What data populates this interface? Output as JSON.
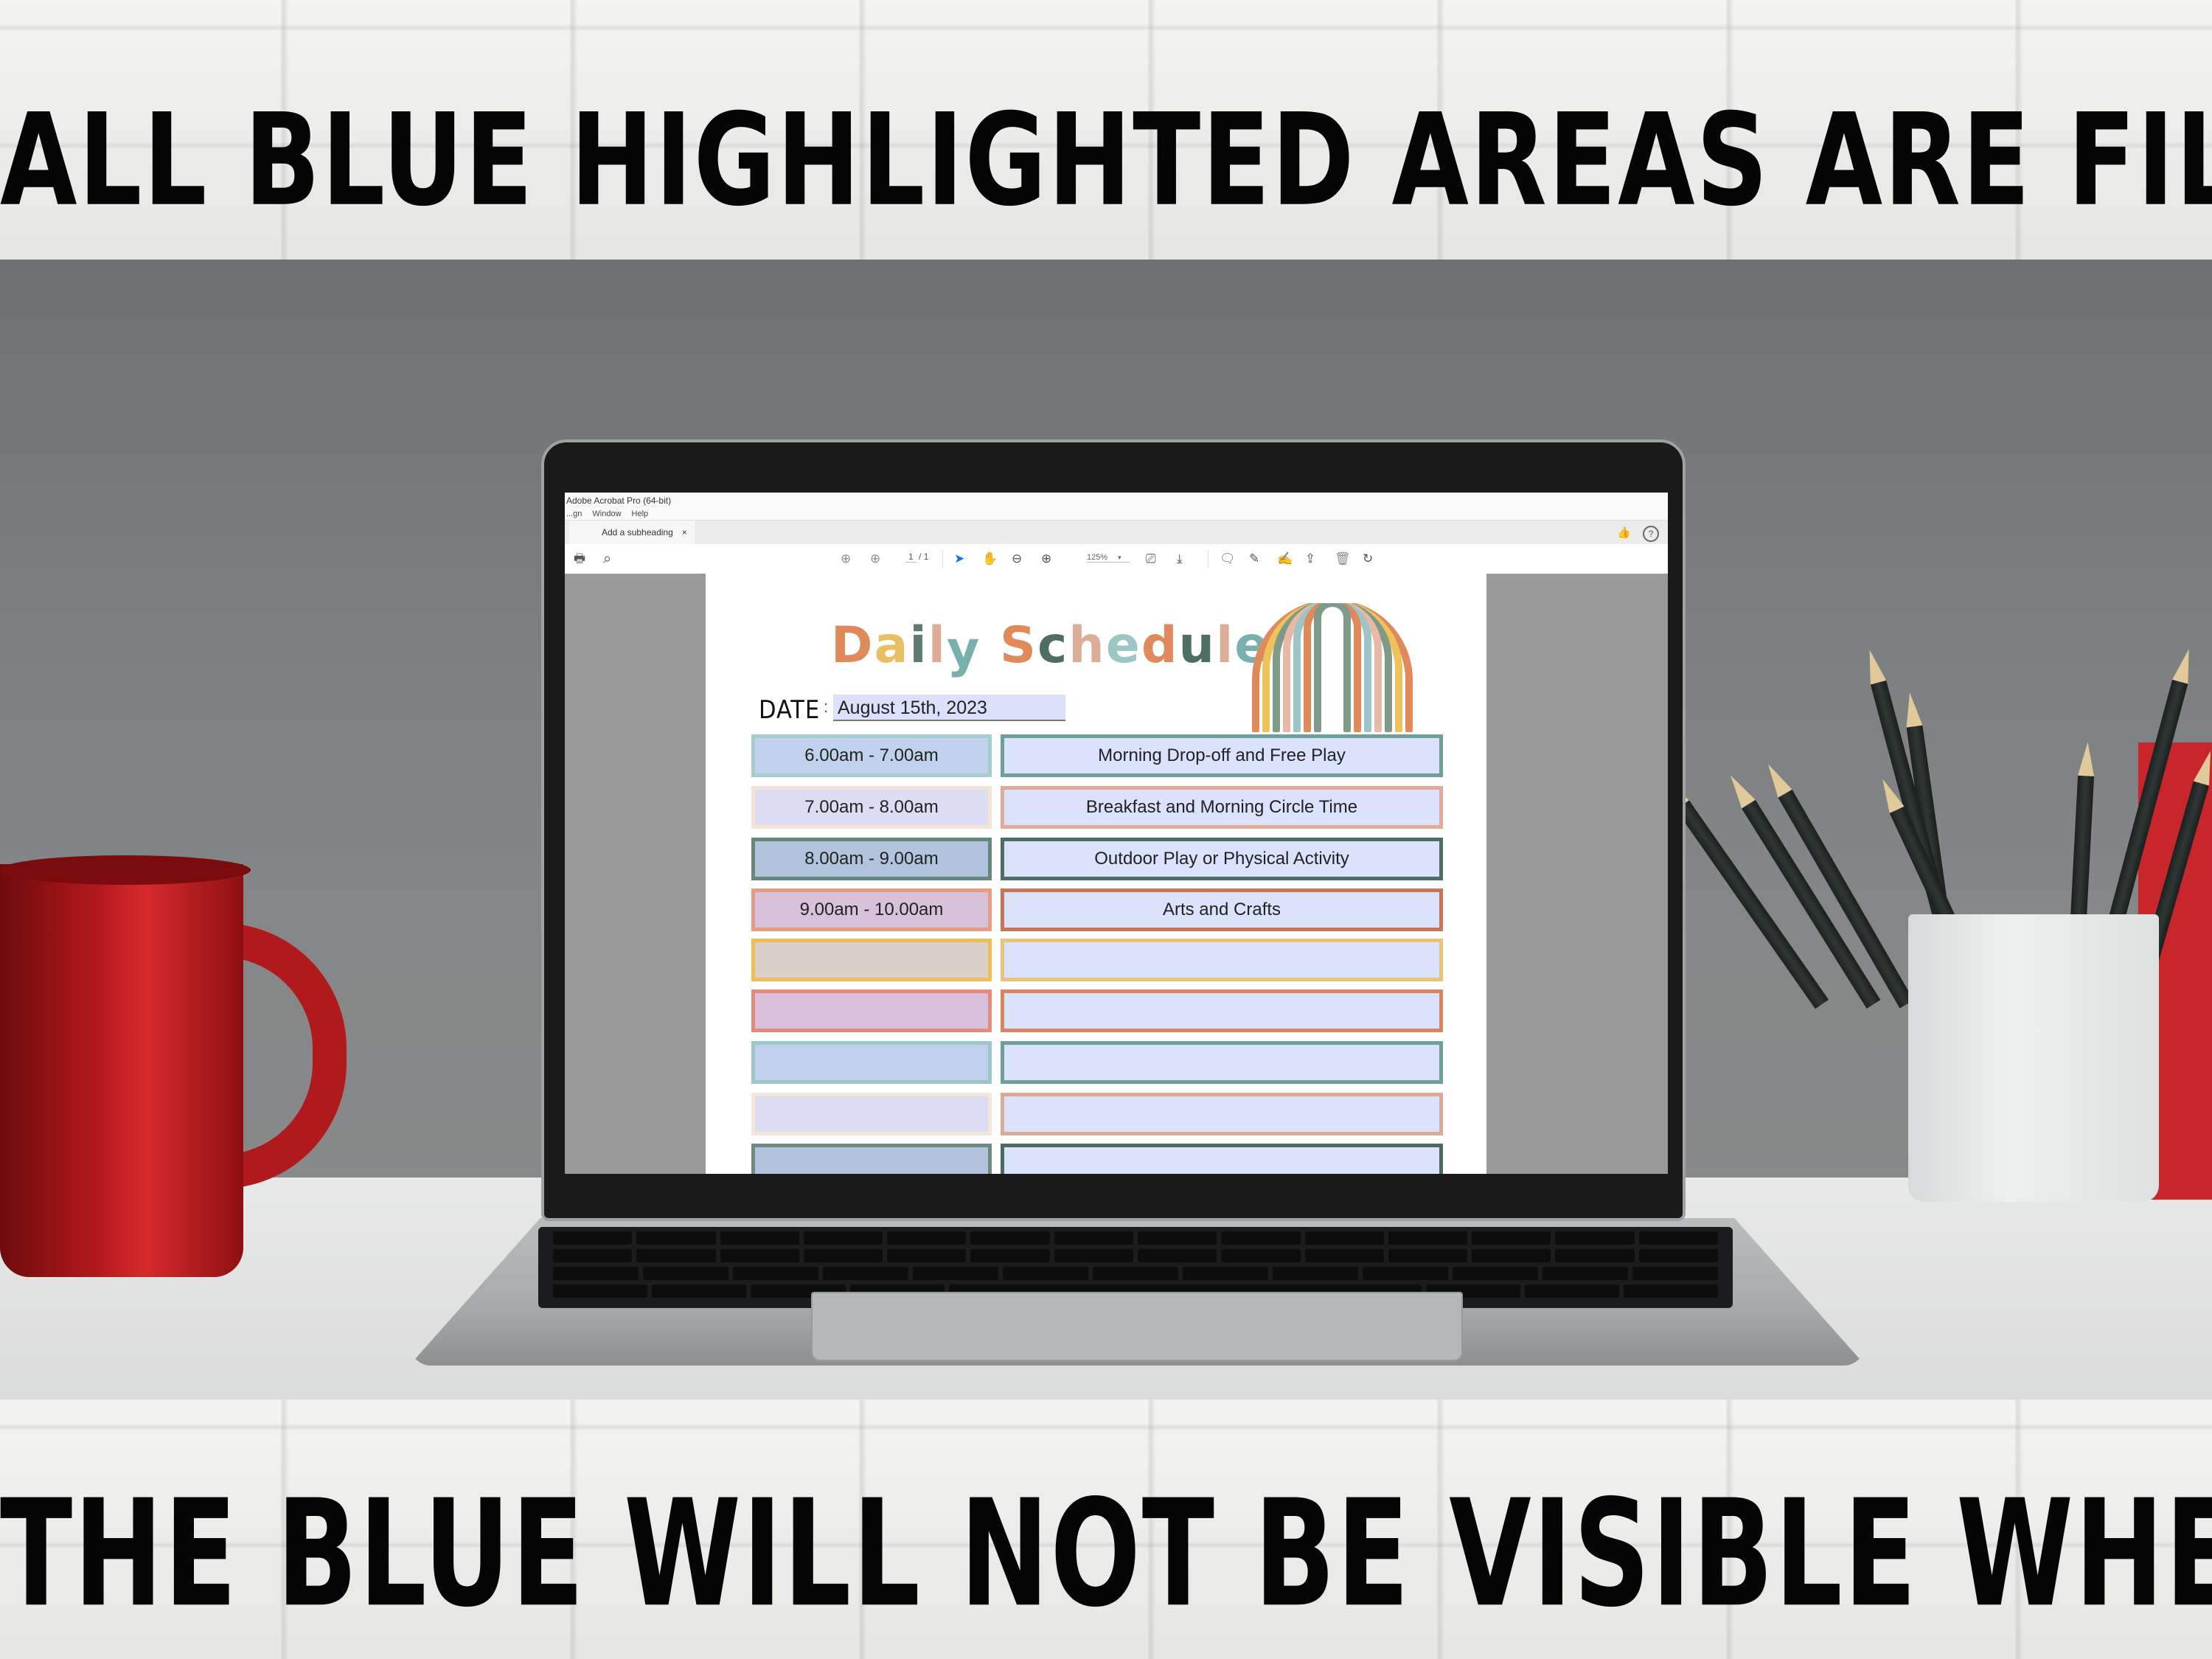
{
  "banners": {
    "top": "ALL BLUE HIGHLIGHTED AREAS ARE FILLABLE",
    "bottom": "THE BLUE WILL NOT BE VISIBLE WHEN PRINTED"
  },
  "app": {
    "window_title": "Adobe Acrobat Pro (64-bit)",
    "menu": [
      "...gn",
      "Window",
      "Help"
    ],
    "tab_label": "Add a subheading",
    "tab_close": "×",
    "toolbar": {
      "page_current": "1",
      "page_total": "/ 1",
      "zoom_level": "125%",
      "zoom_arrow": "▾"
    },
    "icons": {
      "print": "🖶",
      "search": "⌕",
      "page_up": "⊕",
      "page_down": "⊕",
      "select": "➤",
      "hand": "✋",
      "zoom_out": "⊖",
      "zoom_in": "⊕",
      "fit_page": "⎚",
      "scroll_mode": "⤓",
      "comment": "🗨",
      "highlight": "✎",
      "sign": "✍",
      "share": "⇪",
      "delete": "🗑",
      "rotate": "↻",
      "feedback": "👍",
      "help": "?"
    }
  },
  "document": {
    "title_letters": [
      {
        "ch": "D",
        "color": "#e0895b"
      },
      {
        "ch": "a",
        "color": "#e8bf62"
      },
      {
        "ch": "i",
        "color": "#5f7c70"
      },
      {
        "ch": "l",
        "color": "#dcae98"
      },
      {
        "ch": "y",
        "color": "#77b0ac"
      },
      {
        "ch": " ",
        "color": "#ffffff"
      },
      {
        "ch": "S",
        "color": "#e0895b"
      },
      {
        "ch": "c",
        "color": "#4e6d64"
      },
      {
        "ch": "h",
        "color": "#dcae98"
      },
      {
        "ch": "e",
        "color": "#9cc6c4"
      },
      {
        "ch": "d",
        "color": "#e0895b"
      },
      {
        "ch": "u",
        "color": "#4e6d64"
      },
      {
        "ch": "l",
        "color": "#dcae98"
      },
      {
        "ch": "e",
        "color": "#77b0ac"
      }
    ],
    "date_label": "DATE",
    "date_colon": ":",
    "date_value": "August 15th, 2023",
    "rainbow_colors": [
      "#e0895b",
      "#f0c35a",
      "#7f9a88",
      "#e8baa6",
      "#9dc4c6",
      "#e0895b",
      "#7f9a88"
    ],
    "rows": [
      {
        "time": "6.00am - 7.00am",
        "activity": "Morning Drop-off and Free Play",
        "time_bg": "#c0d1ee",
        "time_border": "#a5cdd0",
        "act_border": "#6f9f98"
      },
      {
        "time": "7.00am - 8.00am",
        "activity": "Breakfast and Morning Circle Time",
        "time_bg": "#dcdcf3",
        "time_border": "#f4e4d6",
        "act_border": "#e0ab98"
      },
      {
        "time": "8.00am - 9.00am",
        "activity": "Outdoor Play or Physical Activity",
        "time_bg": "#b2c3dd",
        "time_border": "#65877c",
        "act_border": "#4e6d64"
      },
      {
        "time": "9.00am - 10.00am",
        "activity": "Arts and Crafts",
        "time_bg": "#d8c2da",
        "time_border": "#e69b83",
        "act_border": "#c7745a"
      },
      {
        "time": "",
        "activity": "",
        "time_bg": "#dbd0c8",
        "time_border": "#efbd55",
        "act_border": "#e8c37c"
      },
      {
        "time": "",
        "activity": "",
        "time_bg": "#d8c0da",
        "time_border": "#e58a7d",
        "act_border": "#dc8360"
      },
      {
        "time": "",
        "activity": "",
        "time_bg": "#bfd1ee",
        "time_border": "#9cc6c7",
        "act_border": "#6f9f98"
      },
      {
        "time": "",
        "activity": "",
        "time_bg": "#dbdcf3",
        "time_border": "#f5e6da",
        "act_border": "#dcab98"
      },
      {
        "time": "",
        "activity": "",
        "time_bg": "#b3c3dd",
        "time_border": "#6d8b7e",
        "act_border": "#4e6a60"
      }
    ]
  }
}
